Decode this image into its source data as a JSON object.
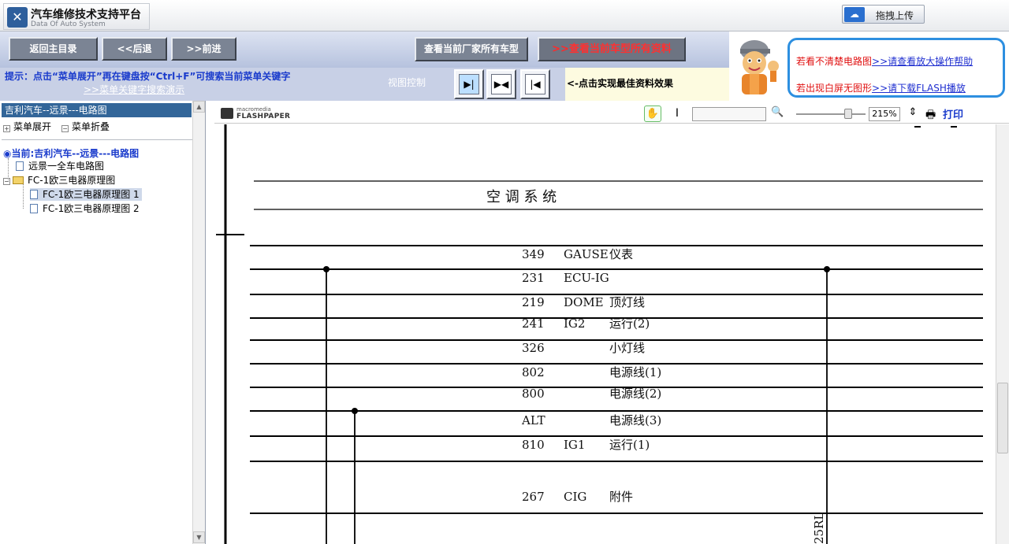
{
  "header": {
    "title": "汽车维修技术支持平台",
    "subtitle": "Data Of Auto System",
    "upload_label": "拖拽上传"
  },
  "toolbar": {
    "home_label": "返回主目录",
    "back_label": "<<后退",
    "forward_label": ">>前进",
    "all_models_label": "查看当前厂家所有车型",
    "all_data_arrows": ">>",
    "all_data_label": "查看当前车型所有资料",
    "tip_line1": "提示：点击“菜单展开”再在键盘按“Ctrl+F”可搜索当前菜单关键字",
    "tip_line2": ">>菜单关键字搜索演示",
    "view_control_label": "视图控制",
    "view_hint": "<-点击实现最佳资料效果"
  },
  "help": {
    "line1_text": "若看不清楚电路图",
    "line1_link": ">>请查看放大操作帮助",
    "line2_text": "若出现白屏无图形",
    "line2_link": ">>请下载FLASH播放"
  },
  "sidebar": {
    "header": "吉利汽车--远景---电路图",
    "menu_expand": "菜单展开",
    "menu_collapse": "菜单折叠",
    "current": "当前:吉利汽车--远景---电路图",
    "items": [
      {
        "label": "远景一全车电路图"
      },
      {
        "label": "FC-1欧三电器原理图"
      },
      {
        "label": "FC-1欧三电器原理图 1"
      },
      {
        "label": "FC-1欧三电器原理图 2"
      }
    ]
  },
  "viewer": {
    "brand_top": "macromedia",
    "brand": "FLASHPAPER",
    "zoom": "215%",
    "zoom_level": 0.75,
    "print_label": "打印",
    "section_title": "空 调 系 统",
    "wires": [
      {
        "code": "349",
        "name": "GAUSE",
        "desc": "仪表"
      },
      {
        "code": "231",
        "name": "ECU-IG",
        "desc": ""
      },
      {
        "code": "219",
        "name": "DOME",
        "desc": "顶灯线"
      },
      {
        "code": "241",
        "name": "IG2",
        "desc": "运行(2)"
      },
      {
        "code": "326",
        "name": "",
        "desc": "小灯线"
      },
      {
        "code": "802",
        "name": "",
        "desc": "电源线(1)"
      },
      {
        "code": "800",
        "name": "",
        "desc": "电源线(2)"
      },
      {
        "code": "ALT",
        "name": "",
        "desc": "电源线(3)"
      },
      {
        "code": "810",
        "name": "IG1",
        "desc": "运行(1)"
      },
      {
        "code": "267",
        "name": "CIG",
        "desc": "附件"
      }
    ],
    "vertical_label": "25RL"
  },
  "icons": {
    "logo": "wrench-logo-icon",
    "upload": "cloud-upload-icon",
    "hand": "hand-tool-icon",
    "find": "magnifier-icon",
    "print": "printer-icon"
  },
  "colors": {
    "accent_blue": "#1a3bcc",
    "sidebar_header": "#336699",
    "toolbar_bg": "#c9d3ea",
    "help_border": "#2d8fe0",
    "alert_red": "#e01010"
  }
}
